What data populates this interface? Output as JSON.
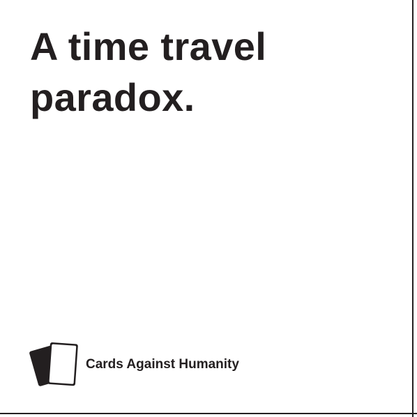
{
  "card": {
    "text_line_1": "A time travel",
    "text_line_2": "paradox.",
    "brand": "Cards Against Humanity",
    "logo_icon": "cards-logo-icon",
    "text_color": "#231f20",
    "background": "#ffffff"
  }
}
